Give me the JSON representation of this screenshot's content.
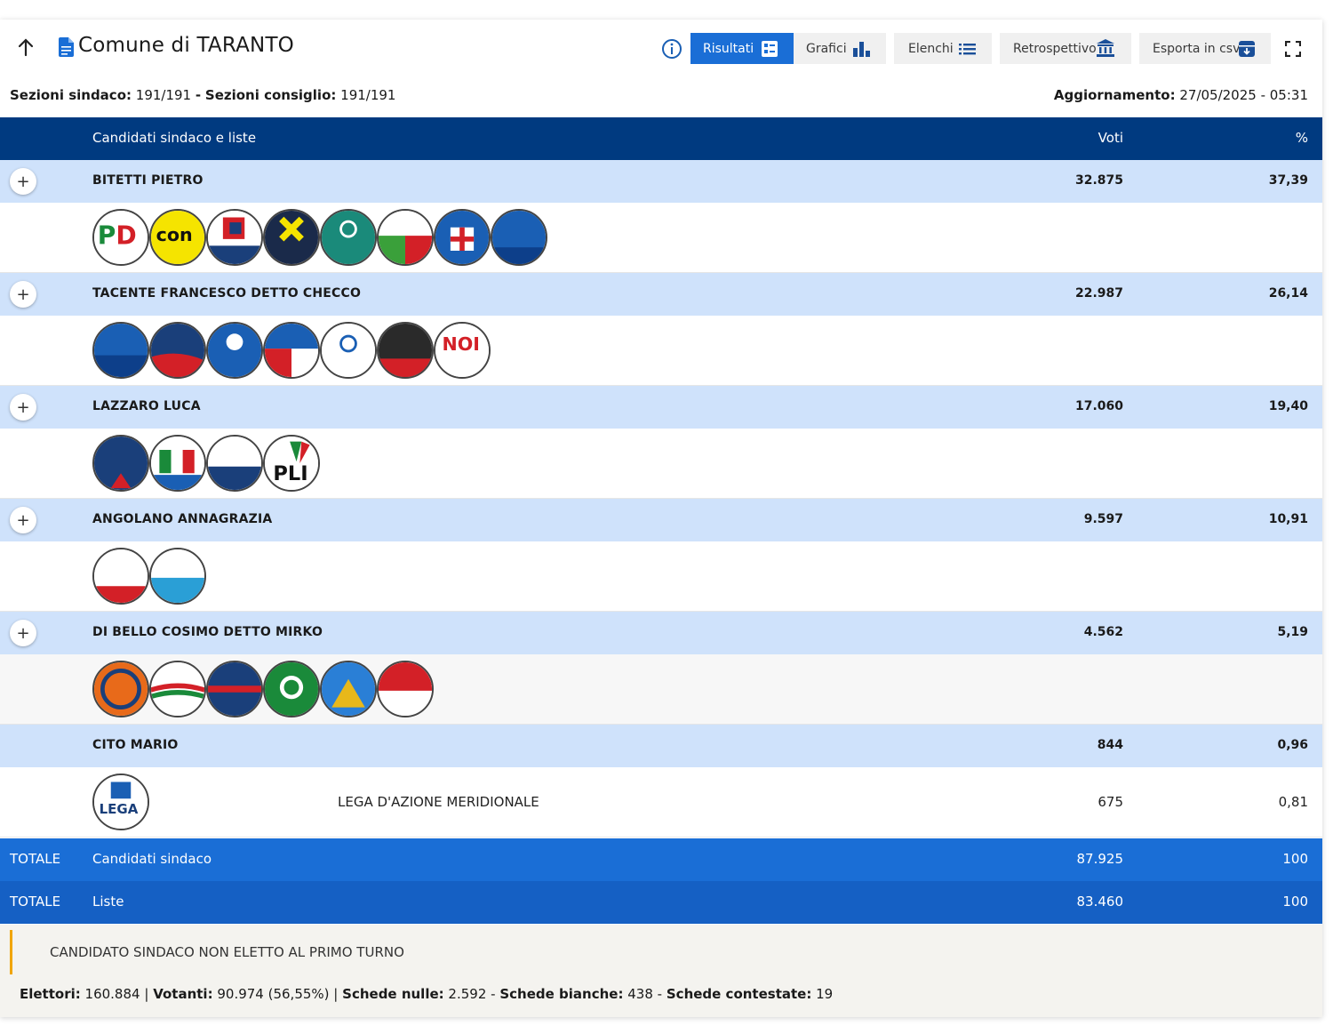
{
  "header": {
    "title": "Comune di TARANTO",
    "buttons": {
      "risultati": "Risultati",
      "grafici": "Grafici",
      "elenchi": "Elenchi",
      "retrospettivo": "Retrospettivo",
      "esporta": "Esporta in csv"
    }
  },
  "meta": {
    "sez_sindaco_label": "Sezioni sindaco:",
    "sez_sindaco_value": "191/191",
    "sep": "-",
    "sez_consiglio_label": "Sezioni consiglio:",
    "sez_consiglio_value": "191/191",
    "agg_label": "Aggiornamento:",
    "agg_value": "27/05/2025 - 05:31"
  },
  "table": {
    "headers": {
      "name": "Candidati sindaco e liste",
      "votes": "Voti",
      "pct": "%"
    },
    "plus_symbol": "+",
    "candidates": [
      {
        "name": "BITETTI PIETRO",
        "votes": "32.875",
        "pct": "37,39"
      },
      {
        "name": "TACENTE FRANCESCO DETTO CHECCO",
        "votes": "22.987",
        "pct": "26,14"
      },
      {
        "name": "LAZZARO LUCA",
        "votes": "17.060",
        "pct": "19,40"
      },
      {
        "name": "ANGOLANO ANNAGRAZIA",
        "votes": "9.597",
        "pct": "10,91"
      },
      {
        "name": "DI BELLO COSIMO DETTO MIRKO",
        "votes": "4.562",
        "pct": "5,19"
      },
      {
        "name": "CITO MARIO",
        "votes": "844",
        "pct": "0,96"
      }
    ],
    "cito_list": {
      "name": "LEGA D'AZIONE MERIDIONALE",
      "votes": "675",
      "pct": "0,81"
    },
    "totals": [
      {
        "label": "TOTALE",
        "name": "Candidati sindaco",
        "votes": "87.925",
        "pct": "100"
      },
      {
        "label": "TOTALE",
        "name": "Liste",
        "votes": "83.460",
        "pct": "100"
      }
    ]
  },
  "footer": {
    "note": "CANDIDATO SINDACO NON ELETTO AL PRIMO TURNO",
    "elettori_label": "Elettori:",
    "elettori_value": "160.884",
    "votanti_label": "Votanti:",
    "votanti_value": "90.974 (56,55%)",
    "nulle_label": "Schede nulle:",
    "nulle_value": "2.592",
    "bianche_label": "Schede bianche:",
    "bianche_value": "438",
    "contestate_label": "Schede contestate:",
    "contestate_value": "19",
    "pipe": "|",
    "dash": "-"
  },
  "colors": {
    "header_bar": "#003a80",
    "candidate_row": "#cfe2fb",
    "active_button": "#1a6ed6",
    "total_row": "#1a6ed6",
    "note_accent": "#f0a500"
  }
}
